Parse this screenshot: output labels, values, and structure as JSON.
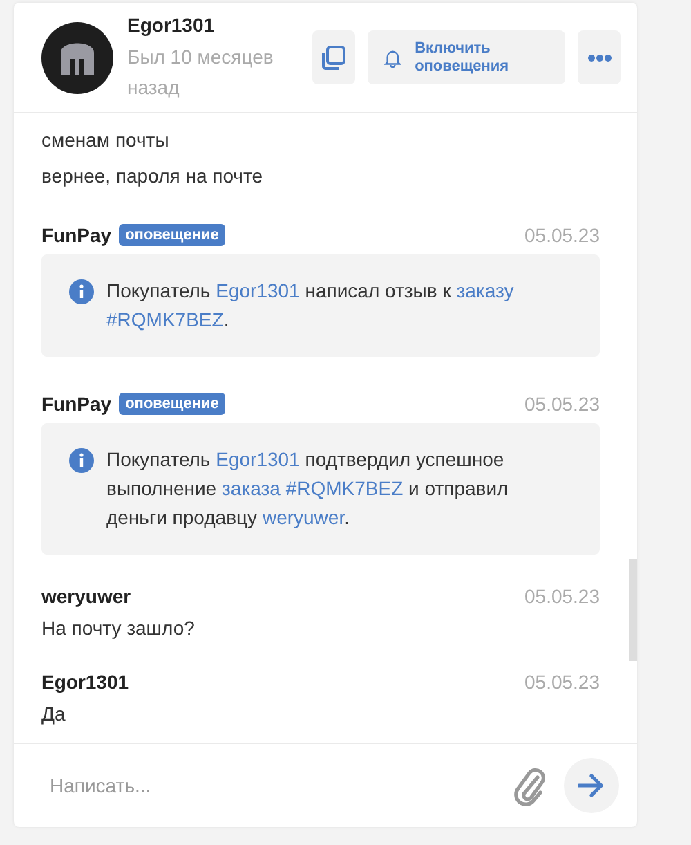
{
  "header": {
    "name": "Egor1301",
    "status": "Был 10 месяцев назад",
    "notify_button": "Включить оповещения"
  },
  "messages": [
    {
      "kind": "line",
      "text": "сменам почты"
    },
    {
      "kind": "line",
      "text": "вернее, пароля на почте"
    },
    {
      "kind": "notice",
      "author": "FunPay",
      "badge": "оповещение",
      "date": "05.05.23",
      "segments": [
        {
          "text": "Покупатель",
          "link": false
        },
        {
          "text": "Egor1301",
          "link": true
        },
        {
          "text": "написал отзыв к",
          "link": false
        },
        {
          "text": "заказу",
          "link": true
        },
        {
          "text": "#RQMK7BEZ",
          "link": true
        },
        {
          "text": ".",
          "link": false
        }
      ]
    },
    {
      "kind": "notice",
      "author": "FunPay",
      "badge": "оповещение",
      "date": "05.05.23",
      "segments": [
        {
          "text": "Покупатель",
          "link": false
        },
        {
          "text": "Egor1301",
          "link": true
        },
        {
          "text": "подтвердил успешное выполнение",
          "link": false
        },
        {
          "text": "заказа #RQMK7BEZ",
          "link": true
        },
        {
          "text": "и отправил деньги продавцу",
          "link": false
        },
        {
          "text": "weryuwer",
          "link": true
        },
        {
          "text": ".",
          "link": false
        }
      ]
    },
    {
      "kind": "message",
      "author": "weryuwer",
      "date": "05.05.23",
      "text": "На почту зашло?"
    },
    {
      "kind": "message",
      "author": "Egor1301",
      "date": "05.05.23",
      "text": "Да"
    }
  ],
  "composer": {
    "placeholder": "Написать..."
  }
}
